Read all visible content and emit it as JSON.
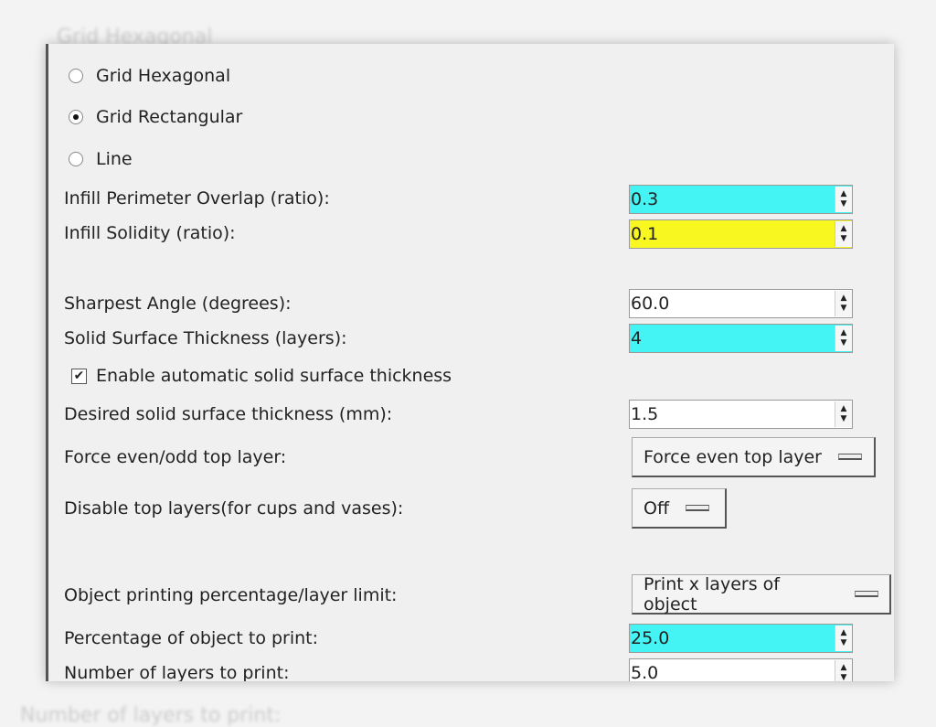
{
  "fill_pattern_options": [
    {
      "label": "Grid Hexagonal",
      "selected": false
    },
    {
      "label": "Grid Rectangular",
      "selected": true
    },
    {
      "label": "Line",
      "selected": false
    }
  ],
  "fields": {
    "infill_perimeter_overlap": {
      "label": "Infill Perimeter Overlap (ratio):",
      "value": "0.3",
      "color": "#44f4f4"
    },
    "infill_solidity": {
      "label": "Infill Solidity (ratio):",
      "value": "0.1",
      "color": "#f8f820"
    },
    "sharpest_angle": {
      "label": "Sharpest Angle (degrees):",
      "value": "60.0",
      "color": "#ffffff"
    },
    "solid_surface_thickness": {
      "label": "Solid Surface Thickness (layers):",
      "value": "4",
      "color": "#44f4f4"
    },
    "auto_solid": {
      "label": "Enable automatic solid surface thickness",
      "checked": true
    },
    "desired_thickness": {
      "label": "Desired solid surface thickness (mm):",
      "value": "1.5",
      "color": "#ffffff"
    },
    "force_even_odd": {
      "label": "Force even/odd top layer:",
      "value": "Force even top layer"
    },
    "disable_top": {
      "label": "Disable top layers(for cups and vases):",
      "value": "Off"
    },
    "object_limit": {
      "label": "Object printing percentage/layer limit:",
      "value": "Print x layers of object"
    },
    "percentage": {
      "label": "Percentage of object to print:",
      "value": "25.0",
      "color": "#44f4f4"
    },
    "num_layers": {
      "label": "Number of layers to print:",
      "value": "5.0",
      "color": "#ffffff"
    }
  }
}
